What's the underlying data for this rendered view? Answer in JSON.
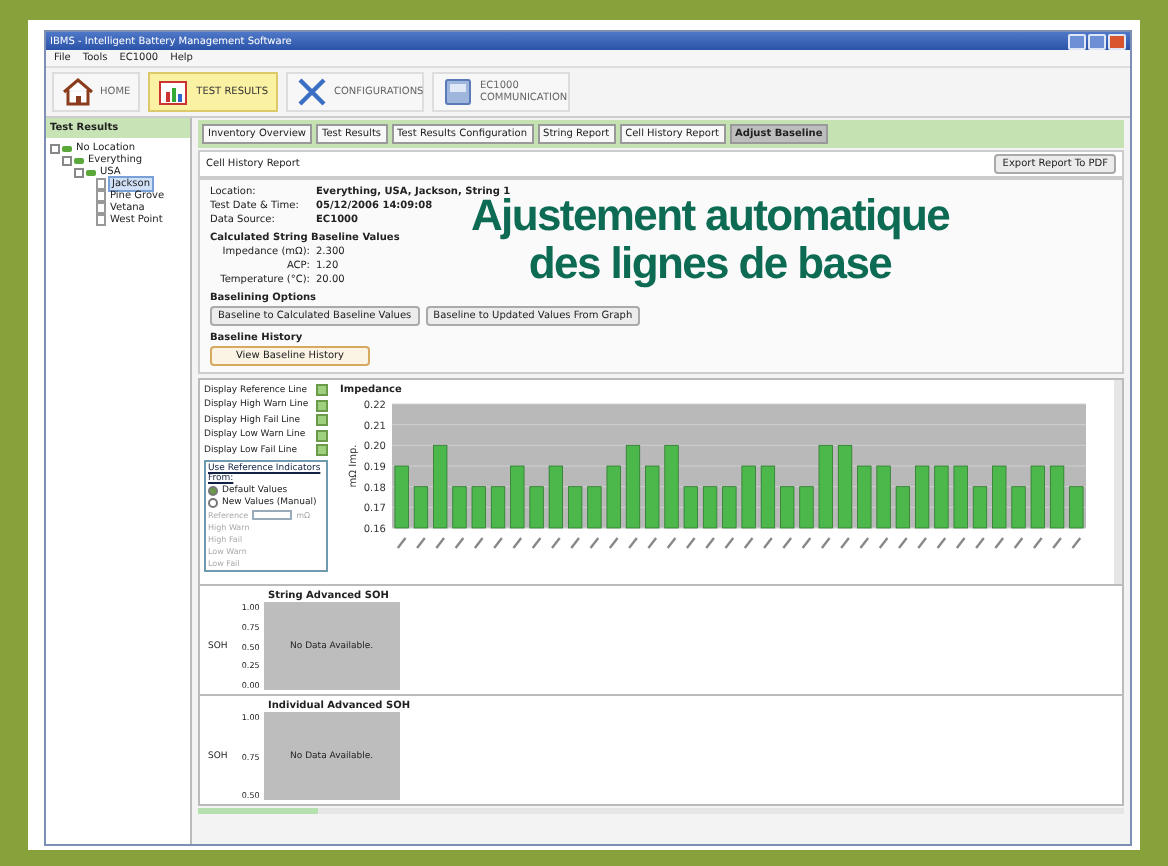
{
  "window": {
    "title": "IBMS - Intelligent Battery Management Software"
  },
  "menu": [
    "File",
    "Tools",
    "EC1000",
    "Help"
  ],
  "toolbar": [
    {
      "label": "HOME",
      "kind": "home",
      "selected": false
    },
    {
      "label": "TEST RESULTS",
      "kind": "results",
      "selected": true
    },
    {
      "label": "CONFIGURATIONS",
      "kind": "config",
      "selected": false
    },
    {
      "label": "EC1000 COMMUNICATION",
      "kind": "comm",
      "selected": false
    }
  ],
  "sidebar": {
    "title": "Test Results",
    "tree": [
      {
        "label": "No Location",
        "children": [
          {
            "label": "Everything",
            "children": [
              {
                "label": "USA",
                "children": [
                  {
                    "label": "Jackson",
                    "selected": true
                  },
                  {
                    "label": "Pine Grove",
                    "selected": false
                  },
                  {
                    "label": "Vetana",
                    "selected": false
                  },
                  {
                    "label": "West Point",
                    "selected": false
                  }
                ]
              }
            ]
          }
        ]
      }
    ]
  },
  "tabs": [
    {
      "label": "Inventory Overview",
      "selected": false
    },
    {
      "label": "Test Results",
      "selected": false
    },
    {
      "label": "Test Results Configuration",
      "selected": false
    },
    {
      "label": "String Report",
      "selected": false
    },
    {
      "label": "Cell History Report",
      "selected": false
    },
    {
      "label": "Adjust Baseline",
      "selected": true
    }
  ],
  "report": {
    "title": "Cell History Report",
    "export_button": "Export Report To PDF",
    "fields": [
      {
        "label": "Location:",
        "value": "Everything, USA, Jackson, String 1"
      },
      {
        "label": "Test Date & Time:",
        "value": "05/12/2006 14:09:08"
      },
      {
        "label": "Data Source:",
        "value": "EC1000"
      }
    ],
    "baseline_heading": "Calculated String Baseline Values",
    "baseline_values": [
      {
        "label": "Impedance (mΩ):",
        "value": "2.300"
      },
      {
        "label": "ACP:",
        "value": "1.20"
      },
      {
        "label": "Temperature (°C):",
        "value": "20.00"
      }
    ],
    "options_heading": "Baselining Options",
    "option_buttons": [
      "Baseline to Calculated Baseline Values",
      "Baseline to Updated Values From Graph"
    ],
    "history_heading": "Baseline History",
    "history_button": "View Baseline History"
  },
  "caption": [
    "Ajustement automatique",
    "des lignes de base"
  ],
  "display_options": [
    {
      "label": "Display Reference Line",
      "checked": true
    },
    {
      "label": "Display High Warn Line",
      "checked": true
    },
    {
      "label": "Display High Fail Line",
      "checked": true
    },
    {
      "label": "Display Low Warn Line",
      "checked": true
    },
    {
      "label": "Display Low Fail Line",
      "checked": true
    }
  ],
  "indicators": {
    "title": "Use Reference Indicators From:",
    "radios": [
      {
        "label": "Default Values",
        "selected": true
      },
      {
        "label": "New Values (Manual)",
        "selected": false
      }
    ],
    "unit": "mΩ",
    "rows": [
      "Reference",
      "High Warn",
      "High Fail",
      "Low Warn",
      "Low Fail"
    ]
  },
  "impedance_chart": {
    "chart_data": {
      "type": "bar",
      "title": "Impedance",
      "ylabel": "mΩ Imp.",
      "ylim": [
        0.16,
        0.22
      ],
      "grid": true,
      "yticks": [
        {
          "value": 0.16,
          "label": "0.16"
        },
        {
          "value": 0.17,
          "label": "0.17"
        },
        {
          "value": 0.18,
          "label": "0.18"
        },
        {
          "value": 0.19,
          "label": "0.19"
        },
        {
          "value": 0.2,
          "label": "0.20"
        },
        {
          "value": 0.21,
          "label": "0.21"
        },
        {
          "value": 0.22,
          "label": "0.22"
        }
      ],
      "series": [
        {
          "color": "#4cb84c",
          "values": [
            0.19,
            0.18,
            0.2,
            0.18,
            0.18,
            0.18,
            0.19,
            0.18,
            0.19,
            0.18,
            0.18,
            0.19,
            0.2,
            0.19,
            0.2,
            0.18,
            0.18,
            0.18,
            0.19,
            0.19,
            0.18,
            0.18,
            0.2,
            0.2,
            0.19,
            0.19,
            0.18,
            0.19,
            0.19,
            0.19,
            0.18,
            0.19,
            0.18,
            0.19,
            0.19,
            0.18
          ]
        }
      ]
    }
  },
  "soh_charts": [
    {
      "title": "String Advanced SOH",
      "ylabel": "SOH",
      "yticks": [
        "1.00",
        "0.75",
        "0.50",
        "0.25",
        "0.00"
      ],
      "message": "No Data Available."
    },
    {
      "title": "Individual Advanced SOH",
      "ylabel": "SOH",
      "yticks": [
        "1.00",
        "0.75",
        "0.50"
      ],
      "message": "No Data Available."
    }
  ]
}
